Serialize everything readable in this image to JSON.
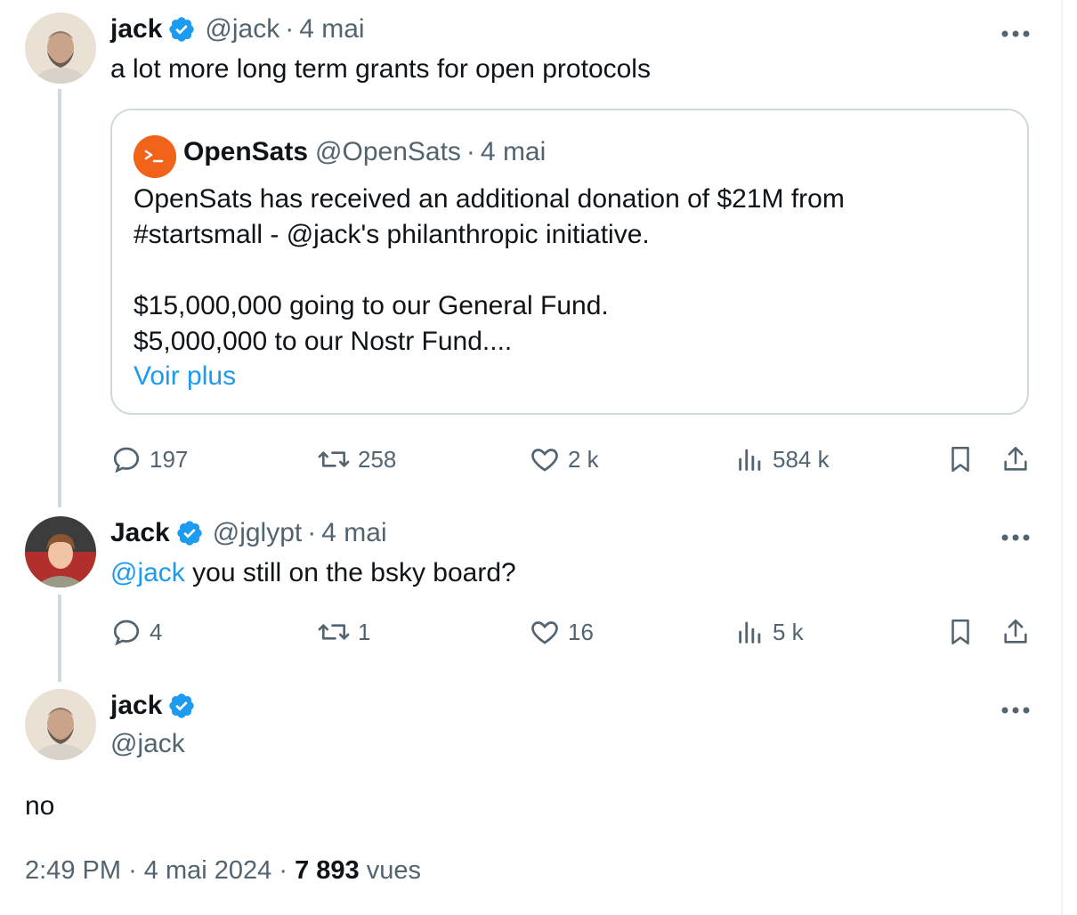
{
  "tweets": [
    {
      "name": "jack",
      "handle": "@jack",
      "separator": "·",
      "date": "4 mai",
      "text": "a lot more long term grants for open protocols",
      "quote": {
        "name": "OpenSats",
        "handle": "@OpenSats",
        "separator": "·",
        "date": "4 mai",
        "lines": [
          "OpenSats has received an additional donation of $21M from",
          "#startsmall - @jack's philanthropic initiative.",
          "",
          "$15,000,000 going to our General Fund.",
          "$5,000,000 to our Nostr Fund...."
        ],
        "see_more": "Voir plus",
        "logo_color": "#f2631a"
      },
      "stats": {
        "replies": "197",
        "retweets": "258",
        "likes": "2 k",
        "views": "584 k"
      }
    },
    {
      "name": "Jack",
      "handle": "@jglypt",
      "separator": "·",
      "date": "4 mai",
      "mention": "@jack",
      "text": " you still on the bsky board?",
      "stats": {
        "replies": "4",
        "retweets": "1",
        "likes": "16",
        "views": "5 k"
      }
    }
  ],
  "main_tweet": {
    "name": "jack",
    "handle": "@jack",
    "text": "no",
    "time": "2:49 PM",
    "separator": "·",
    "date": "4 mai 2024",
    "views_count": "7 893",
    "views_label": "vues"
  },
  "colors": {
    "accent": "#1d9bf0",
    "secondary_text": "#536471",
    "border": "#cfd9de",
    "verified": "#1d9bf0"
  },
  "icons": [
    "verified-badge-icon",
    "more-icon",
    "reply-icon",
    "retweet-icon",
    "like-icon",
    "views-icon",
    "bookmark-icon",
    "share-icon",
    "opensats-logo-icon"
  ]
}
